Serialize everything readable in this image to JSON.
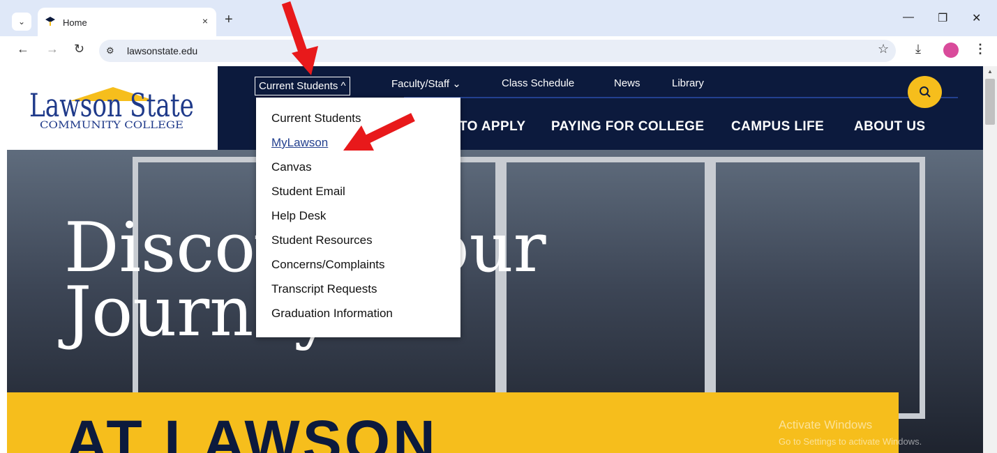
{
  "browser": {
    "tab_title": "Home",
    "tab_close": "×",
    "new_tab": "+",
    "url": "lawsonstate.edu"
  },
  "header": {
    "logo": {
      "primary": "Lawson State",
      "secondary": "COMMUNITY COLLEGE"
    },
    "util_nav": [
      {
        "label": "Current Students ^"
      },
      {
        "label": "Faculty/Staff ⌄"
      },
      {
        "label": "Class Schedule"
      },
      {
        "label": "News"
      },
      {
        "label": "Library"
      }
    ],
    "main_nav": [
      {
        "label": "TO APPLY"
      },
      {
        "label": "PAYING FOR COLLEGE"
      },
      {
        "label": "CAMPUS LIFE"
      },
      {
        "label": "ABOUT US"
      }
    ]
  },
  "dropdown": {
    "items": [
      {
        "label": "Current Students"
      },
      {
        "label": "MyLawson"
      },
      {
        "label": "Canvas"
      },
      {
        "label": "Student Email"
      },
      {
        "label": "Help Desk"
      },
      {
        "label": "Student Resources"
      },
      {
        "label": "Concerns/Complaints"
      },
      {
        "label": "Transcript Requests"
      },
      {
        "label": "Graduation Information"
      }
    ]
  },
  "hero": {
    "line1": "Discover Your",
    "line2": "Journey",
    "band": "AT LAWSON"
  },
  "watermark": {
    "title": "Activate Windows",
    "subtitle": "Go to Settings to activate Windows."
  },
  "colors": {
    "navy": "#0c1a3d",
    "gold": "#f6be1c",
    "link_blue": "#23408f",
    "annotation_red": "#e8191b"
  }
}
